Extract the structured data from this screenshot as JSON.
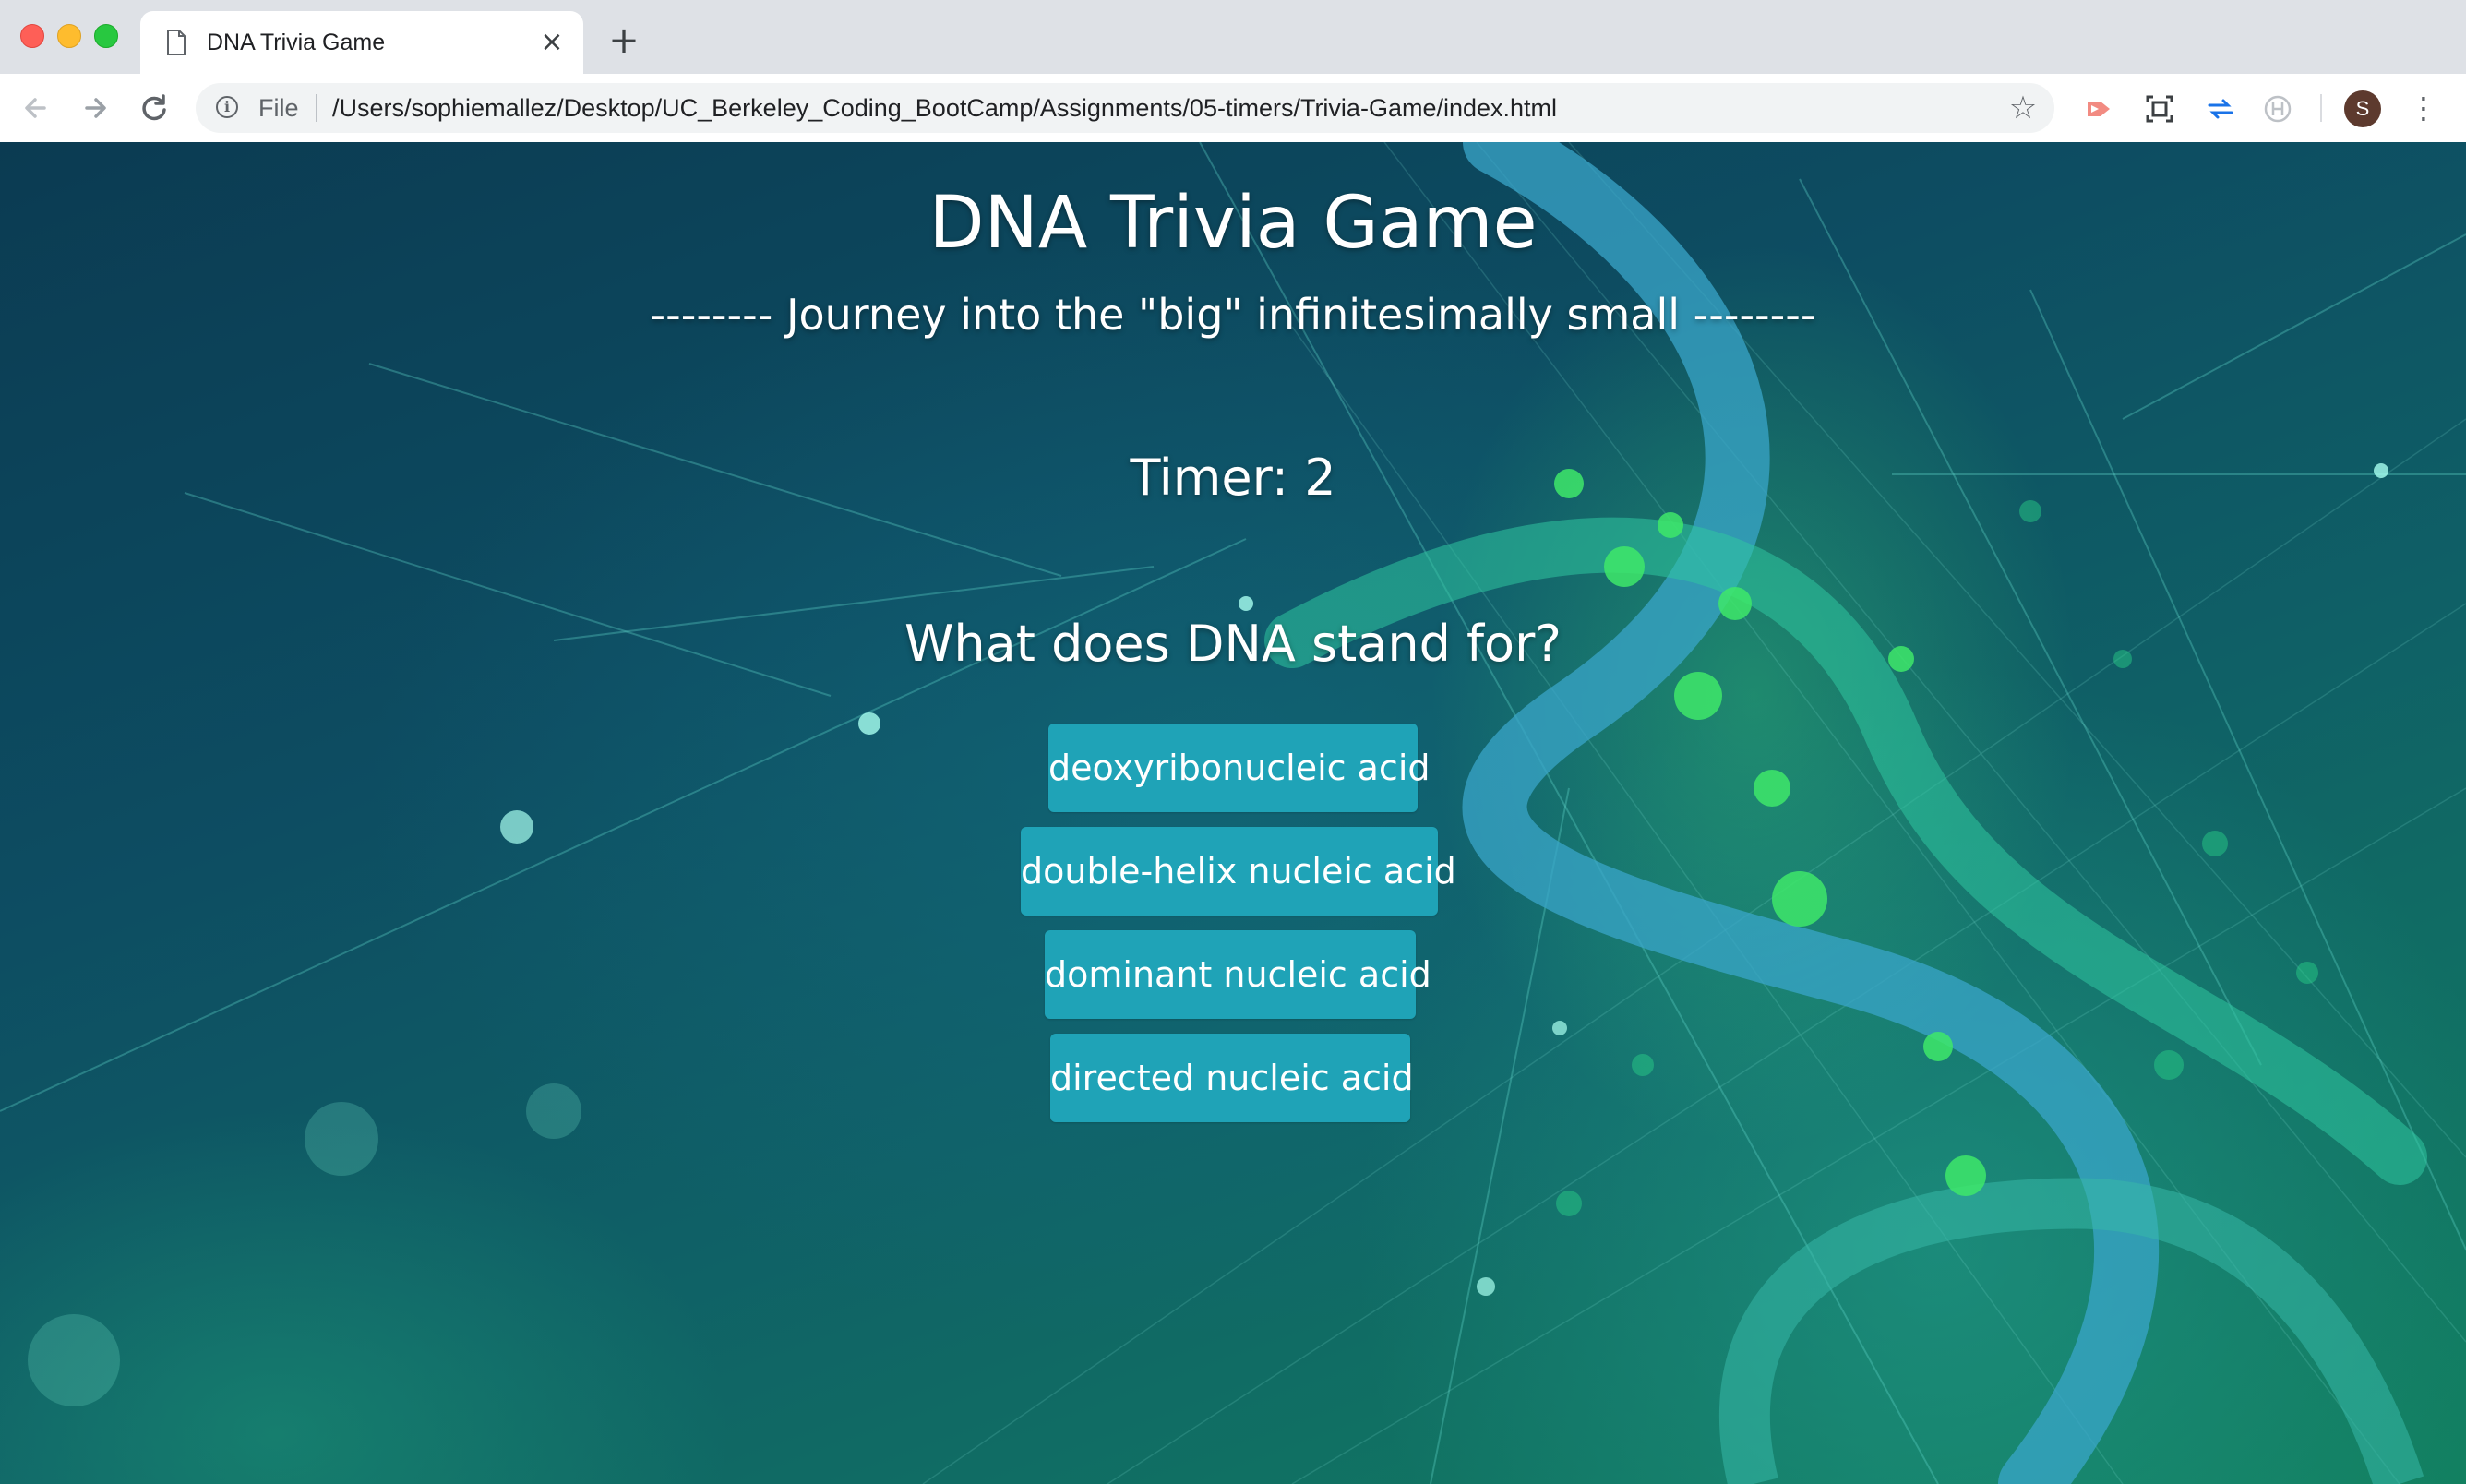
{
  "browser": {
    "tab_title": "DNA Trivia Game",
    "close_glyph": "×",
    "new_tab_glyph": "+",
    "address_scheme": "File",
    "address_url": "/Users/sophiemallez/Desktop/UC_Berkeley_Coding_BootCamp/Assignments/05-timers/Trivia-Game/index.html",
    "profile_initial": "S",
    "icons": {
      "back": "arrow-left-icon",
      "forward": "arrow-right-icon",
      "reload": "reload-icon",
      "info": "info-icon",
      "bookmark": "star-icon",
      "menu": "kebab-menu-icon"
    }
  },
  "page": {
    "title": "DNA Trivia Game",
    "subtitle": "-------- Journey into the \"big\" infinitesimally small --------",
    "timer_text": "Timer: 2",
    "question": "What does DNA stand for?",
    "answers": [
      "deoxyribonucleic acid",
      "double-helix nucleic acid",
      "dominant nucleic acid",
      "directed nucleic acid"
    ],
    "colors": {
      "button_bg": "#1fa3b7",
      "text": "#ffffff"
    }
  }
}
